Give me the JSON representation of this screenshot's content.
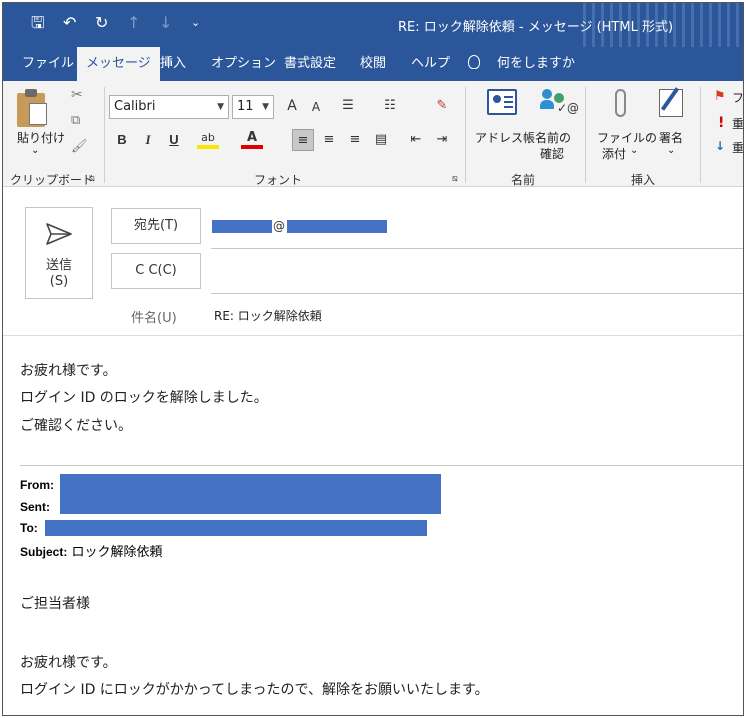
{
  "titlebar": {
    "title": "RE: ロック解除依頼  -  メッセージ (HTML 形式)",
    "icons": [
      "save-icon",
      "undo-icon",
      "redo-icon",
      "up-arrow-icon",
      "down-arrow-icon",
      "customize-icon"
    ],
    "glyphs": {
      "save": "🖫",
      "undo": "↶",
      "redo": "↻",
      "up": "↑",
      "down": "↓",
      "customize": "⌄"
    },
    "color": "#2b579a"
  },
  "tabs": [
    {
      "label": "ファイル"
    },
    {
      "label": "メッセージ",
      "active": true
    },
    {
      "label": "挿入"
    },
    {
      "label": "オプション"
    },
    {
      "label": "書式設定"
    },
    {
      "label": "校閲"
    },
    {
      "label": "ヘルプ"
    }
  ],
  "tellme": "何をしますか",
  "ribbon": {
    "clipboard": {
      "paste": "貼り付け",
      "paste_arrow": "⌄",
      "cut": "✂",
      "copy": "⧉",
      "format_painter": "🖌",
      "label": "クリップボード",
      "launcher": "⧅"
    },
    "font": {
      "name": "Calibri",
      "size": "11",
      "grow": "A",
      "shrink": "A",
      "bullets": "☰",
      "numbering": "☷",
      "clear": "✎",
      "bold": "B",
      "italic": "I",
      "underline": "U",
      "highlight": "ab",
      "fontcolor": "A",
      "align_left": "≡",
      "align_center": "≡",
      "align_right": "≡",
      "justify": "▤",
      "outdent": "⇤",
      "indent": "⇥",
      "label": "フォント",
      "launcher": "⧅"
    },
    "names": {
      "address_book": "アドレス帳",
      "check_names_1": "名前の",
      "check_names_2": "確認",
      "label": "名前"
    },
    "insert": {
      "attach_1": "ファイルの",
      "attach_2": "添付",
      "attach_arrow": "⌄",
      "signature": "署名",
      "signature_arrow": "⌄",
      "label": "挿入"
    },
    "tags": {
      "flag": "⚑",
      "flag_text": "フ",
      "important": "!",
      "important_text": "重",
      "low": "↓",
      "low_text": "重"
    }
  },
  "compose": {
    "send_line1": "送信",
    "send_line2": "(S)",
    "to_button": "宛先(T)",
    "to_at": "@",
    "cc_button": "C C(C)",
    "subject_label": "件名(U)",
    "subject_value": "RE: ロック解除依頼"
  },
  "body": {
    "line1": "お疲れ様です。",
    "line2": "ログイン ID のロックを解除しました。",
    "line3": "ご確認ください。"
  },
  "quoted": {
    "from_label": "From:",
    "sent_label": "Sent:",
    "to_label": "To:",
    "subject_label": "Subject:",
    "subject_value": " ロック解除依頼",
    "greeting": "ご担当者様",
    "line1": "お疲れ様です。",
    "line2": "ログイン ID にロックがかかってしまったので、解除をお願いいたします。"
  },
  "colors": {
    "accent": "#2b579a",
    "redaction": "#4472c4"
  }
}
